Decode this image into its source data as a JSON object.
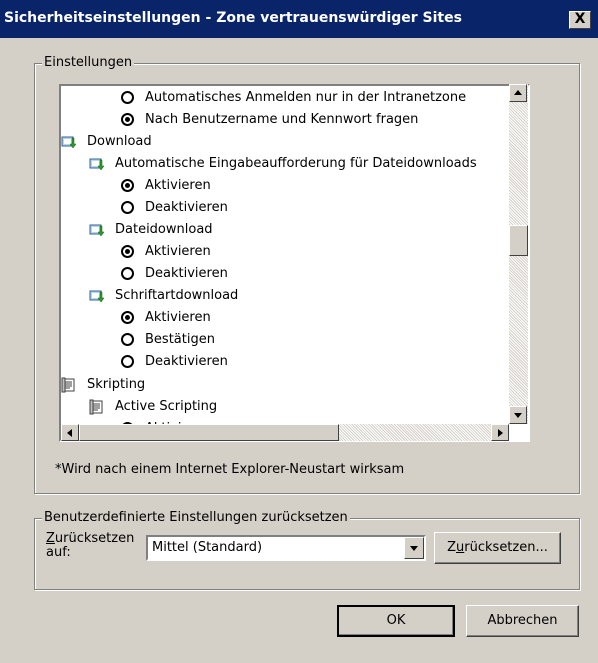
{
  "window": {
    "title": "Sicherheitseinstellungen - Zone vertrauenswürdiger Sites",
    "close_glyph": "X"
  },
  "settings_group": {
    "legend": "Einstellungen",
    "items": [
      {
        "kind": "radio",
        "checked": false,
        "label": "Automatisches Anmelden nur in der Intranetzone"
      },
      {
        "kind": "radio",
        "checked": true,
        "label": "Nach Benutzername und Kennwort fragen"
      },
      {
        "kind": "category",
        "icon": "download-icon",
        "label": "Download"
      },
      {
        "kind": "setting",
        "icon": "download-icon",
        "label": "Automatische Eingabeaufforderung für Dateidownloads"
      },
      {
        "kind": "radio",
        "checked": true,
        "label": "Aktivieren"
      },
      {
        "kind": "radio",
        "checked": false,
        "label": "Deaktivieren"
      },
      {
        "kind": "setting",
        "icon": "download-icon",
        "label": "Dateidownload"
      },
      {
        "kind": "radio",
        "checked": true,
        "label": "Aktivieren"
      },
      {
        "kind": "radio",
        "checked": false,
        "label": "Deaktivieren"
      },
      {
        "kind": "setting",
        "icon": "download-icon",
        "label": "Schriftartdownload"
      },
      {
        "kind": "radio",
        "checked": true,
        "label": "Aktivieren"
      },
      {
        "kind": "radio",
        "checked": false,
        "label": "Bestätigen"
      },
      {
        "kind": "radio",
        "checked": false,
        "label": "Deaktivieren"
      },
      {
        "kind": "category",
        "icon": "script-icon",
        "label": "Skripting"
      },
      {
        "kind": "setting",
        "icon": "script-icon",
        "label": "Active Scripting"
      },
      {
        "kind": "radio",
        "checked": true,
        "label": "Aktivieren"
      }
    ],
    "note": "*Wird nach einem Internet Explorer-Neustart wirksam"
  },
  "reset_group": {
    "legend": "Benutzerdefinierte Einstellungen zurücksetzen",
    "label_prefix": "Z",
    "label_rest": "urücksetzen",
    "label_line2": "auf:",
    "selected": "Mittel (Standard)",
    "reset_button_prefix": "Z",
    "reset_button_u": "u",
    "reset_button_rest": "rücksetzen..."
  },
  "buttons": {
    "ok": "OK",
    "cancel": "Abbrechen"
  },
  "colors": {
    "titlebar": "#0a246a",
    "face": "#d4d0c8"
  }
}
